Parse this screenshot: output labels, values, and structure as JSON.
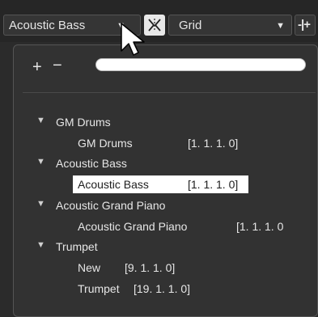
{
  "toolbar": {
    "instrument_select": {
      "value": "Acoustic Bass",
      "arrow": "▼"
    },
    "snap_icon": "snap-icon",
    "grid_select": {
      "value": "Grid",
      "arrow": "▼"
    },
    "quantize_label": "-|+"
  },
  "dropdown": {
    "add_label": "+",
    "remove_label": "−",
    "filter_value": "",
    "tree": [
      {
        "group": "GM Drums",
        "children": [
          {
            "name": "GM Drums",
            "position": "[1. 1. 1.  0]"
          }
        ]
      },
      {
        "group": "Acoustic Bass",
        "children": [
          {
            "name": "Acoustic Bass",
            "position": "[1. 1. 1.  0]",
            "selected": true
          }
        ]
      },
      {
        "group": "Acoustic Grand Piano",
        "children": [
          {
            "name": "Acoustic Grand Piano",
            "position": "[1. 1. 1.  0"
          }
        ]
      },
      {
        "group": "Trumpet",
        "children": [
          {
            "name": "New",
            "position": "[9. 1. 1.  0]"
          },
          {
            "name": "Trumpet",
            "position": "[19. 1. 1.  0]"
          }
        ]
      }
    ]
  },
  "colors": {
    "background": "#2b2b2b",
    "panel": "#323232",
    "selection": "#ffffff"
  }
}
